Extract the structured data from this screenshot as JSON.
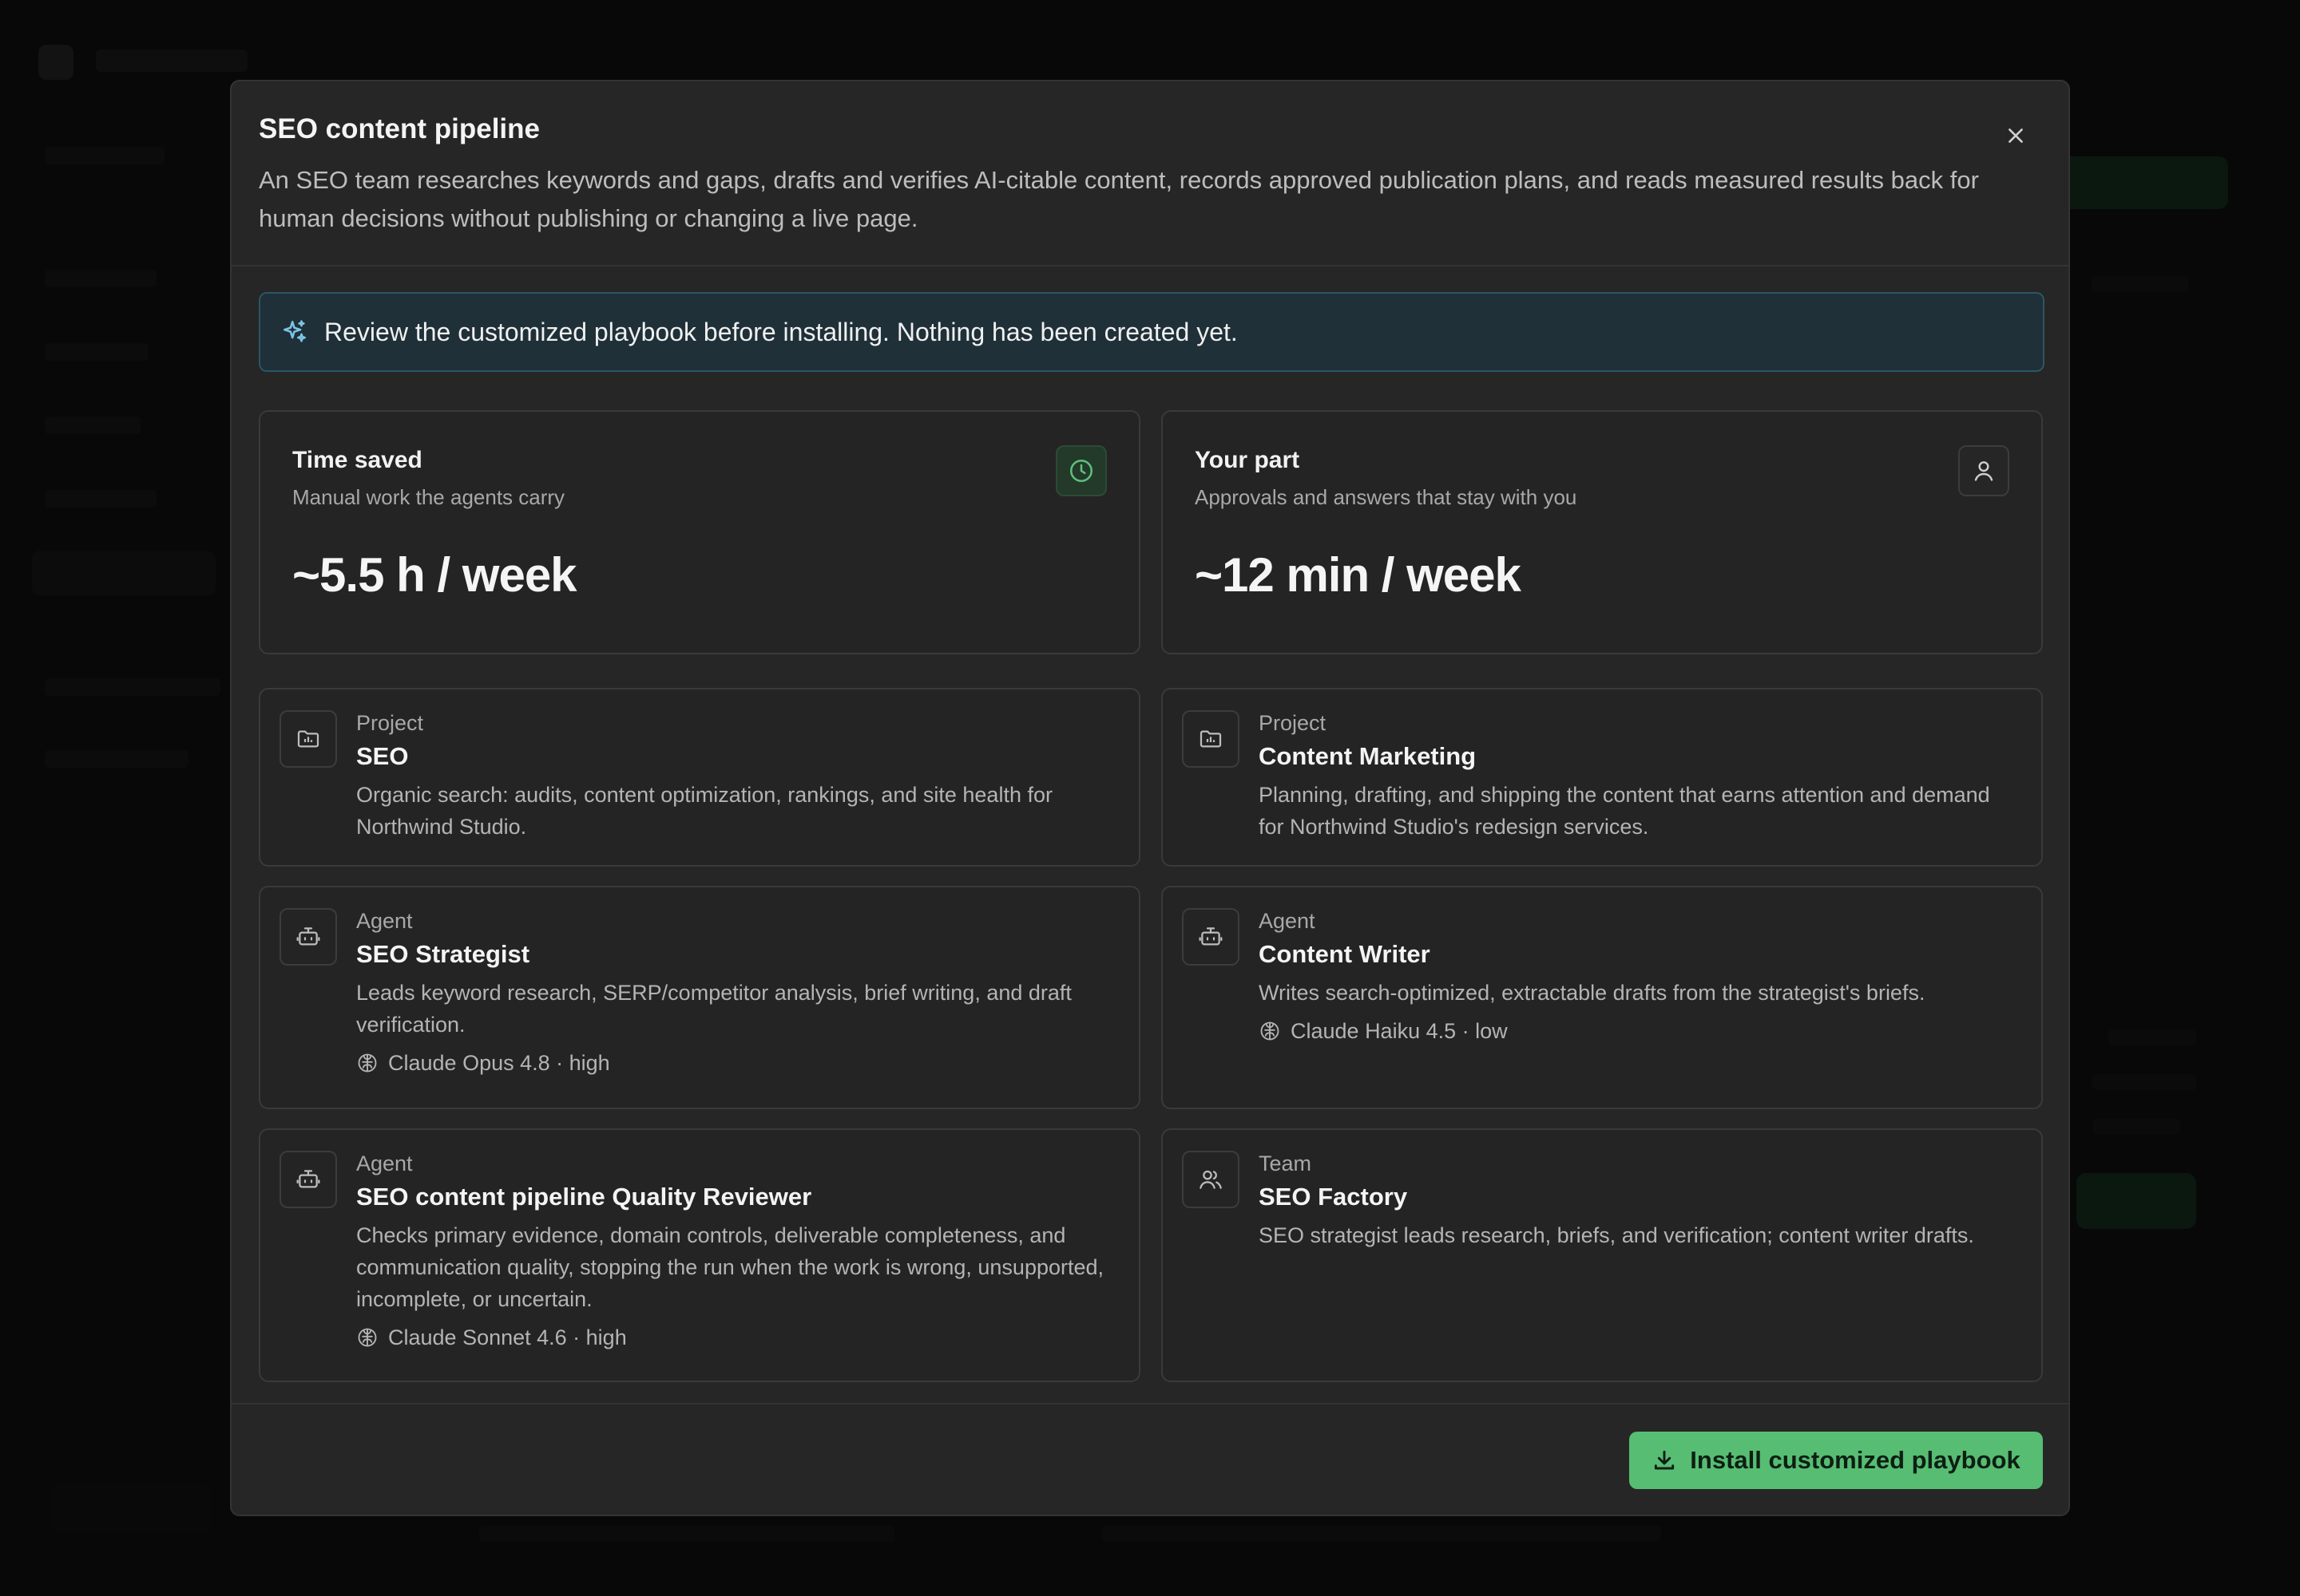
{
  "modal": {
    "title": "SEO content pipeline",
    "description": "An SEO team researches keywords and gaps, drafts and verifies AI-citable content, records approved publication plans, and reads measured results back for human decisions without publishing or changing a live page."
  },
  "banner": {
    "text": "Review the customized playbook before installing. Nothing has been created yet.",
    "icon": "sparkles-icon"
  },
  "stats": [
    {
      "title": "Time saved",
      "subtitle": "Manual work the agents carry",
      "value": "~5.5 h / week",
      "icon": "clock-icon",
      "icon_color": "#5fbf7a"
    },
    {
      "title": "Your part",
      "subtitle": "Approvals and answers that stay with you",
      "value": "~12 min / week",
      "icon": "user-icon"
    }
  ],
  "resources": [
    {
      "kind": "Project",
      "name": "SEO",
      "description": "Organic search: audits, content optimization, rankings, and site health for Northwind Studio.",
      "icon": "folder-chart-icon"
    },
    {
      "kind": "Project",
      "name": "Content Marketing",
      "description": "Planning, drafting, and shipping the content that earns attention and demand for Northwind Studio's redesign services.",
      "icon": "folder-chart-icon"
    },
    {
      "kind": "Agent",
      "name": "SEO Strategist",
      "description": "Leads keyword research, SERP/competitor analysis, brief writing, and draft verification.",
      "model": "Claude Opus 4.8 · high",
      "icon": "robot-icon"
    },
    {
      "kind": "Agent",
      "name": "Content Writer",
      "description": "Writes search-optimized, extractable drafts from the strategist's briefs.",
      "model": "Claude Haiku 4.5 · low",
      "icon": "robot-icon"
    },
    {
      "kind": "Agent",
      "name": "SEO content pipeline Quality Reviewer",
      "description": "Checks primary evidence, domain controls, deliverable completeness, and communication quality, stopping the run when the work is wrong, unsupported, incomplete, or uncertain.",
      "model": "Claude Sonnet 4.6 · high",
      "icon": "robot-icon"
    },
    {
      "kind": "Team",
      "name": "SEO Factory",
      "description": "SEO strategist leads research, briefs, and verification; content writer drafts.",
      "icon": "users-icon"
    }
  ],
  "footer": {
    "install_label": "Install customized playbook",
    "install_icon": "download-icon",
    "accent": "#57bd73"
  },
  "close_icon": "close-icon"
}
